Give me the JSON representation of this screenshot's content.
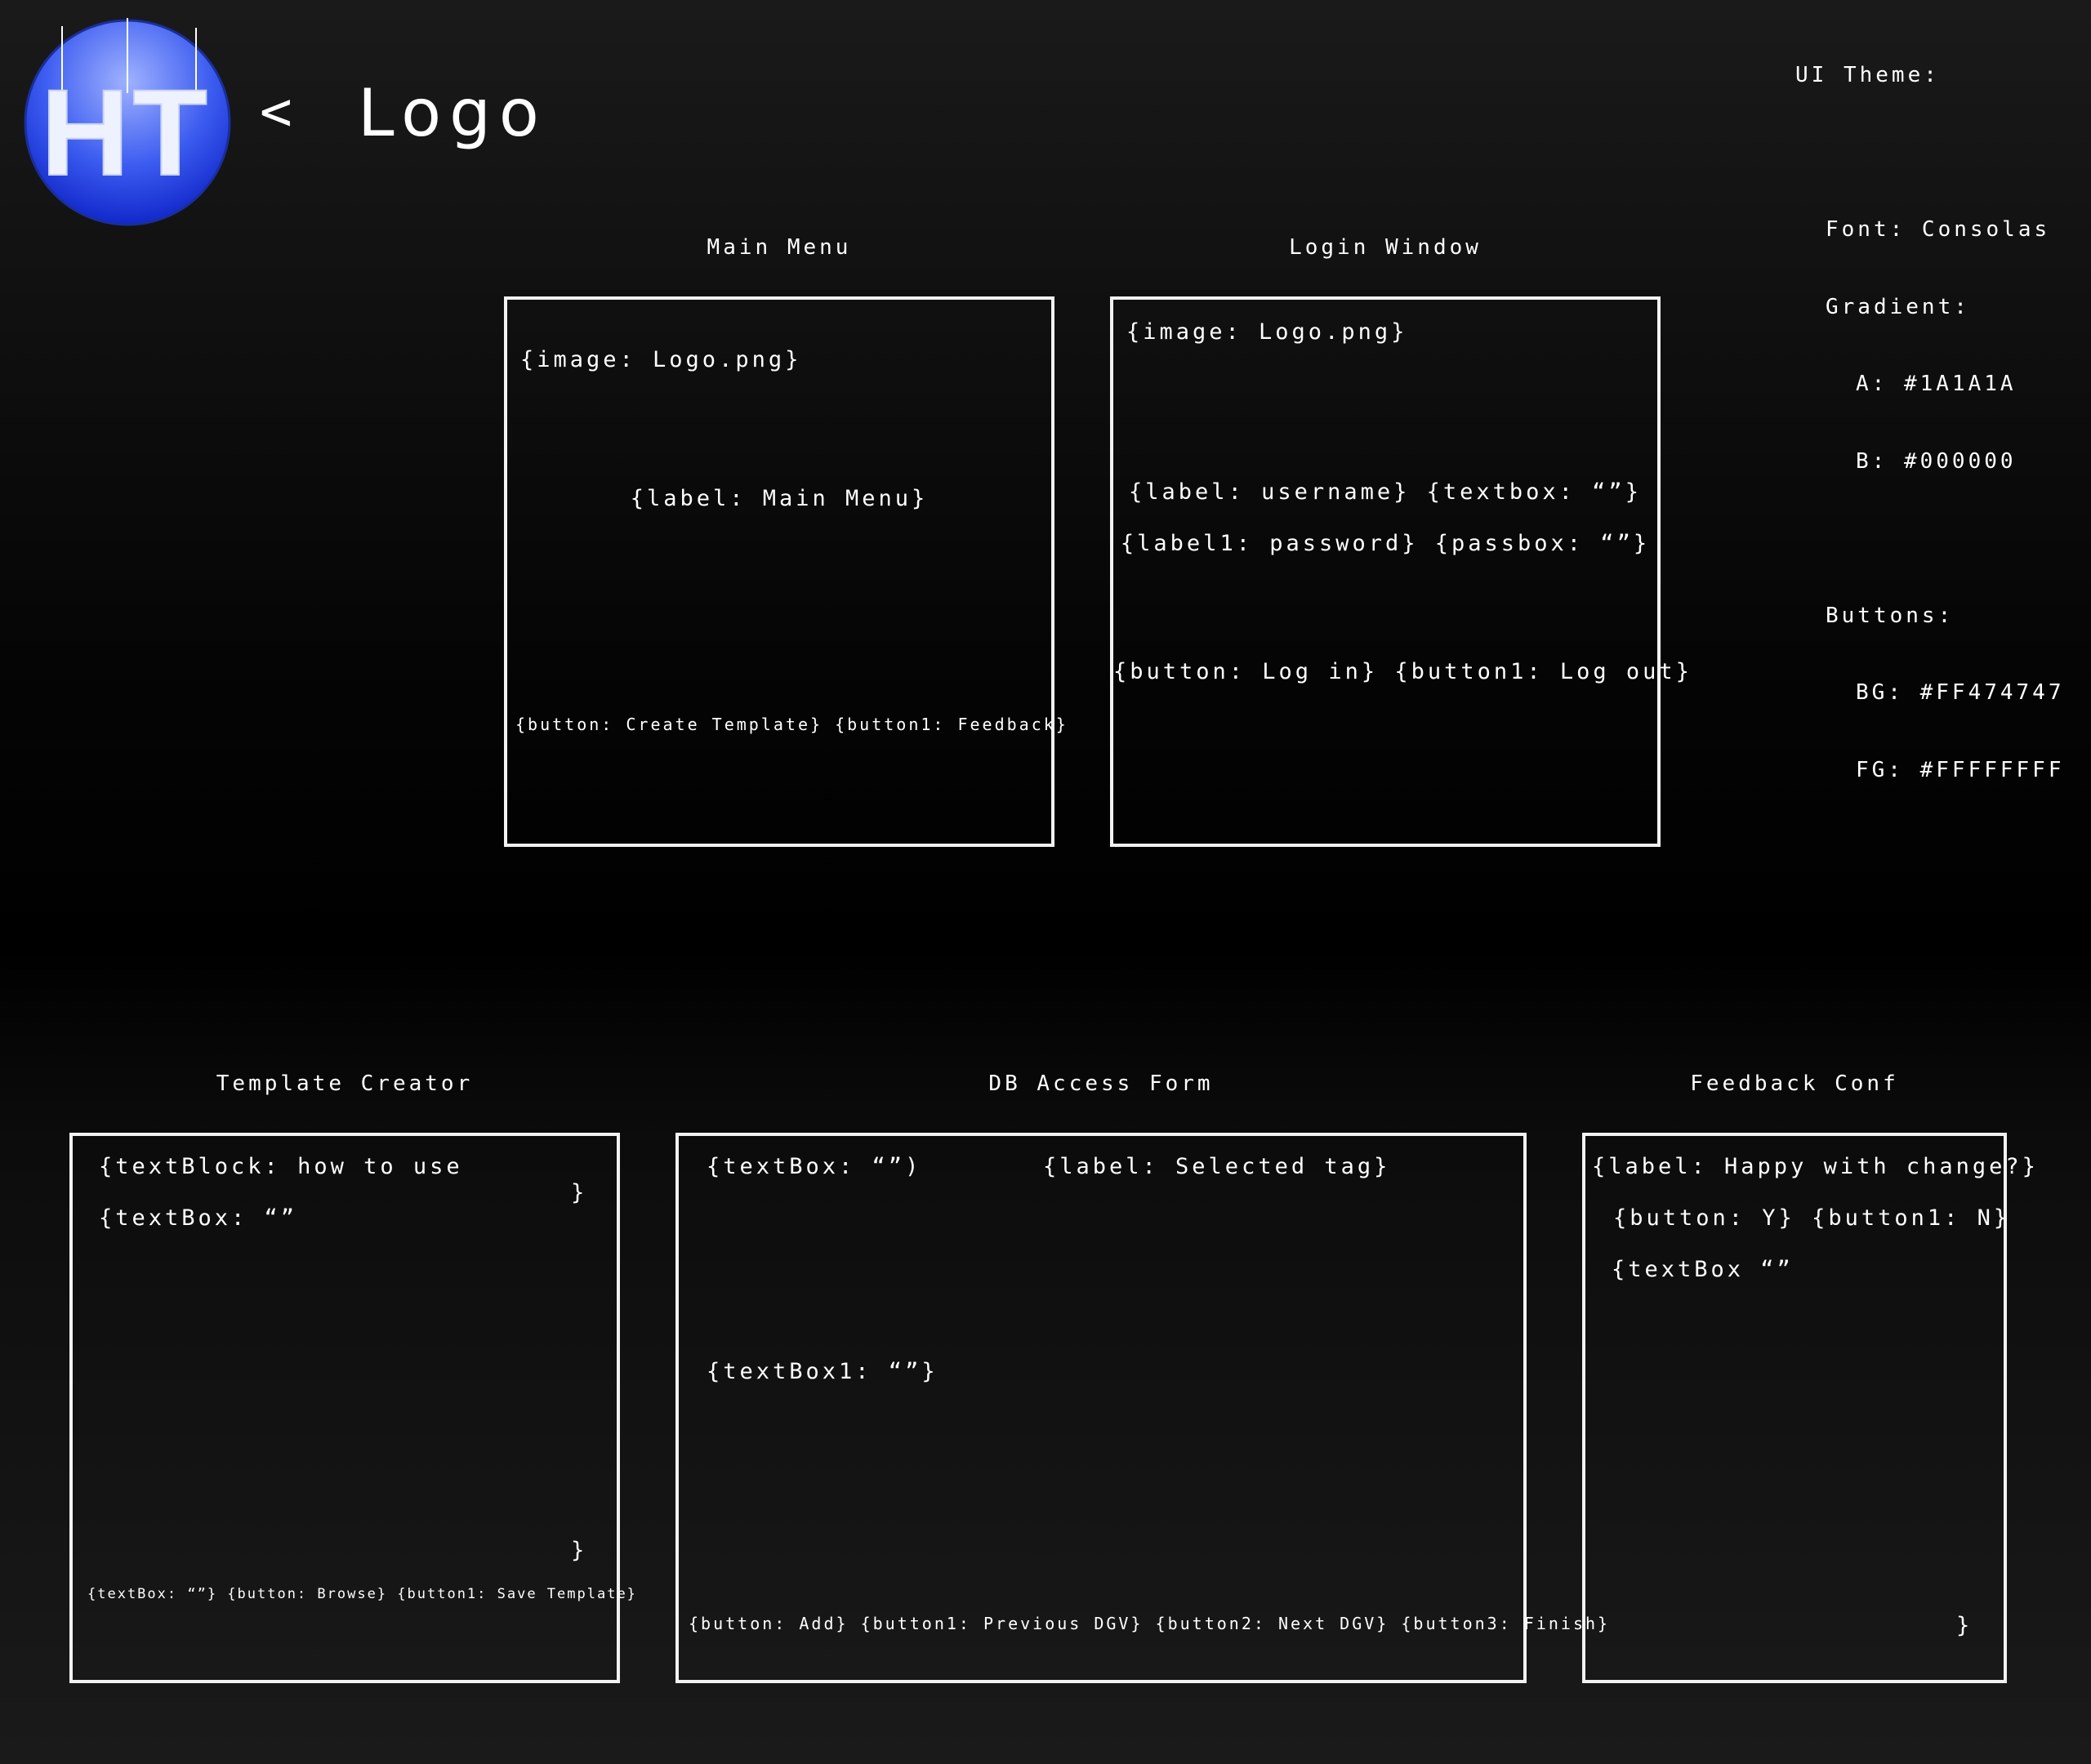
{
  "header": {
    "logo_text": "HT",
    "arrow": "<",
    "logo_caption": "Logo"
  },
  "theme": {
    "heading": "UI Theme:",
    "font_line": "Font: Consolas",
    "gradient_heading": "Gradient:",
    "gradient_a": "A: #1A1A1A",
    "gradient_b": "B: #000000",
    "buttons_heading": "Buttons:",
    "buttons_bg": "BG: #FF474747",
    "buttons_fg": "FG: #FFFFFFFF",
    "colors": {
      "gradient_a": "#1A1A1A",
      "gradient_b": "#000000",
      "button_bg": "#474747",
      "button_fg": "#FFFFFF"
    }
  },
  "main_menu": {
    "title": "Main Menu",
    "image": "{image: Logo.png}",
    "label": "{label: Main Menu}",
    "buttons": "{button: Create Template} {button1: Feedback}"
  },
  "login": {
    "title": "Login Window",
    "image": "{image: Logo.png}",
    "username_row": "{label: username} {textbox: “”}",
    "password_row": "{label1: password} {passbox: “”}",
    "buttons": "{button: Log in} {button1: Log out}"
  },
  "template_creator": {
    "title": "Template Creator",
    "text_block": "{textBlock: how to use",
    "brace_top": "}",
    "text_box": "{textBox: “”",
    "brace_bottom": "}",
    "bottom_row": "{textBox: “”} {button: Browse} {button1: Save Template}"
  },
  "db_access": {
    "title": "DB Access Form",
    "text_box": "{textBox: “”)",
    "label": "{label: Selected tag}",
    "text_box1": "{textBox1: “”}",
    "buttons": "{button: Add} {button1: Previous DGV} {button2: Next DGV} {button3: Finish}"
  },
  "feedback": {
    "title": "Feedback Conf",
    "label": "{label: Happy with change?}",
    "buttons": "{button: Y} {button1: N}",
    "text_box": "{textBox “”",
    "brace": "}"
  }
}
